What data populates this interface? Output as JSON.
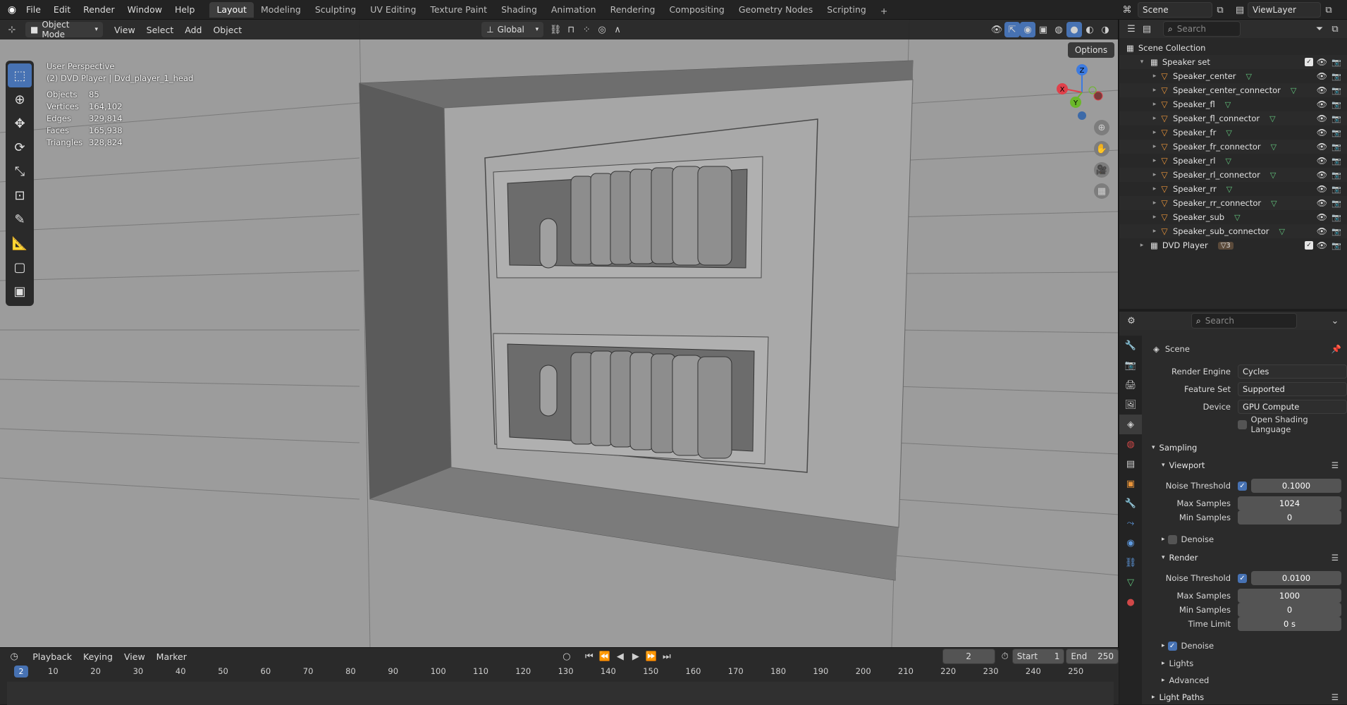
{
  "topbar": {
    "menus": [
      "File",
      "Edit",
      "Render",
      "Window",
      "Help"
    ],
    "workspaces": [
      "Layout",
      "Modeling",
      "Sculpting",
      "UV Editing",
      "Texture Paint",
      "Shading",
      "Animation",
      "Rendering",
      "Compositing",
      "Geometry Nodes",
      "Scripting"
    ],
    "active_workspace": "Layout",
    "add_tab": "+",
    "scene": "Scene",
    "view_layer": "ViewLayer"
  },
  "viewport": {
    "mode": "Object Mode",
    "menus": [
      "View",
      "Select",
      "Add",
      "Object"
    ],
    "orientation": "Global",
    "options_label": "Options",
    "perspective": "User Perspective",
    "context": "(2) DVD Player | Dvd_player_1_head",
    "stats": [
      {
        "label": "Objects",
        "value": "85"
      },
      {
        "label": "Vertices",
        "value": "164,102"
      },
      {
        "label": "Edges",
        "value": "329,814"
      },
      {
        "label": "Faces",
        "value": "165,938"
      },
      {
        "label": "Triangles",
        "value": "328,824"
      }
    ],
    "gizmo": {
      "x": "X",
      "y": "Y",
      "z": "Z"
    },
    "tools": [
      "select-box",
      "cursor",
      "move",
      "rotate",
      "scale",
      "transform",
      "annotate",
      "measure",
      "add-cube",
      "add-object"
    ]
  },
  "timeline": {
    "menus": [
      "Playback",
      "Keying",
      "View",
      "Marker"
    ],
    "current_frame": "2",
    "start_label": "Start",
    "start": "1",
    "end_label": "End",
    "end": "250",
    "ticks": [
      "10",
      "20",
      "30",
      "40",
      "50",
      "60",
      "70",
      "80",
      "90",
      "100",
      "110",
      "120",
      "130",
      "140",
      "150",
      "160",
      "170",
      "180",
      "190",
      "200",
      "210",
      "220",
      "230",
      "240",
      "250"
    ],
    "playhead": "2"
  },
  "outliner": {
    "search_placeholder": "Search",
    "root": "Scene Collection",
    "collection": "Speaker set",
    "items": [
      "Speaker_center",
      "Speaker_center_connector",
      "Speaker_fl",
      "Speaker_fl_connector",
      "Speaker_fr",
      "Speaker_fr_connector",
      "Speaker_rl",
      "Speaker_rl_connector",
      "Speaker_rr",
      "Speaker_rr_connector",
      "Speaker_sub",
      "Speaker_sub_connector"
    ],
    "dvd": "DVD Player",
    "dvd_badge": "3"
  },
  "properties": {
    "search_placeholder": "Search",
    "context": "Scene",
    "render_engine_label": "Render Engine",
    "render_engine": "Cycles",
    "feature_set_label": "Feature Set",
    "feature_set": "Supported",
    "device_label": "Device",
    "device": "GPU Compute",
    "osl_label": "Open Shading Language",
    "sampling": "Sampling",
    "viewport_label": "Viewport",
    "noise_threshold_label": "Noise Threshold",
    "vp_noise": "0.1000",
    "max_samples_label": "Max Samples",
    "vp_max": "1024",
    "min_samples_label": "Min Samples",
    "vp_min": "0",
    "denoise_label": "Denoise",
    "render_label": "Render",
    "r_noise": "0.0100",
    "r_max": "1000",
    "r_min": "0",
    "time_limit_label": "Time Limit",
    "time_limit": "0 s",
    "lights_label": "Lights",
    "advanced_label": "Advanced",
    "light_paths_label": "Light Paths"
  }
}
